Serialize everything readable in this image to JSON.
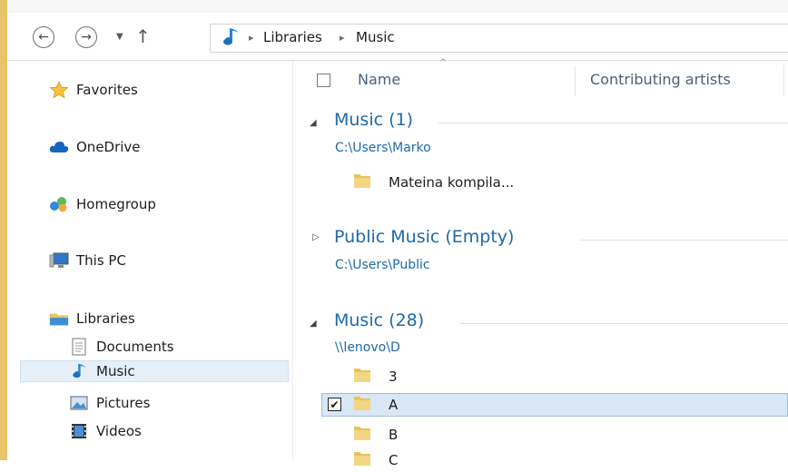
{
  "nav": {
    "back_glyph": "←",
    "forward_glyph": "→",
    "dropdown_glyph": "▼",
    "up_glyph": "↑"
  },
  "address": {
    "sep": "▸",
    "crumbs": [
      "Libraries",
      "Music"
    ]
  },
  "sidebar": {
    "favorites": "Favorites",
    "onedrive": "OneDrive",
    "homegroup": "Homegroup",
    "thispc": "This PC",
    "libraries": "Libraries",
    "documents": "Documents",
    "music": "Music",
    "pictures": "Pictures",
    "videos": "Videos"
  },
  "columns": {
    "name": "Name",
    "sort_glyph": "^",
    "artists": "Contributing artists"
  },
  "groups": [
    {
      "expand_glyph": "◢",
      "title": "Music (1)",
      "path": "C:\\Users\\Marko",
      "items": [
        "Mateina kompila..."
      ]
    },
    {
      "expand_glyph": "▷",
      "title": "Public Music (Empty)",
      "path": "C:\\Users\\Public",
      "items": []
    },
    {
      "expand_glyph": "◢",
      "title": "Music (28)",
      "path": "\\\\lenovo\\D",
      "items": [
        "3",
        "A",
        "B",
        "C"
      ],
      "checked_mark": "✔"
    }
  ],
  "colors": {
    "group_title": "#1e6aa8",
    "selection_bg": "#d8e6f5",
    "selection_border": "#9dbde3",
    "folder": "#e8c25a"
  }
}
